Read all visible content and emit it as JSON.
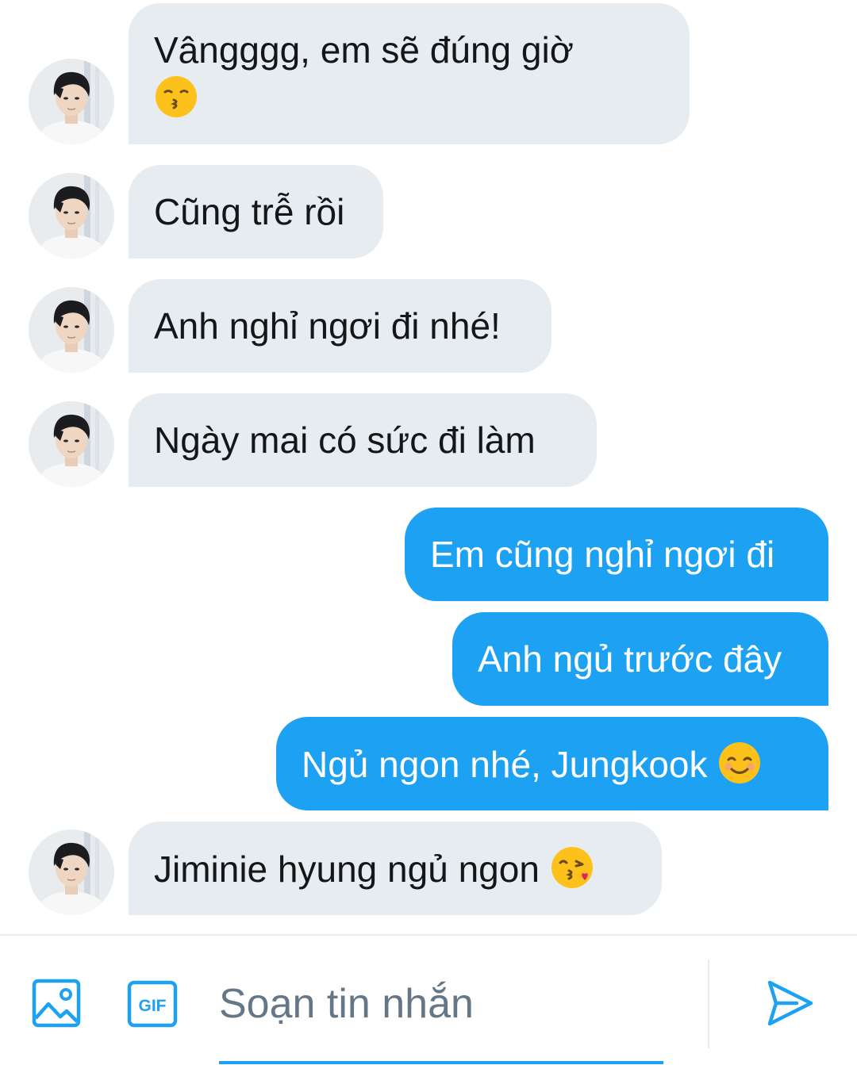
{
  "messages": [
    {
      "side": "in",
      "text_line1": "Vângggg, em sẽ đúng giờ",
      "emoji": "kissing-face"
    },
    {
      "side": "in",
      "text": "Cũng trễ rồi"
    },
    {
      "side": "in",
      "text": "Anh nghỉ ngơi đi nhé!"
    },
    {
      "side": "in",
      "text": "Ngày mai có sức đi làm"
    },
    {
      "side": "out",
      "text": "Em cũng nghỉ ngơi đi"
    },
    {
      "side": "out",
      "text": "Anh ngủ trước đây"
    },
    {
      "side": "out",
      "text": "Ngủ ngon nhé, Jungkook",
      "emoji": "smiling-face"
    },
    {
      "side": "in",
      "text": "Jiminie hyung ngủ ngon",
      "emoji": "face-blowing-kiss"
    }
  ],
  "composer": {
    "placeholder": "Soạn tin nhắn",
    "gif_label": "GIF",
    "media_icon": "image-icon",
    "send_icon": "send-icon"
  },
  "colors": {
    "incoming_bubble": "#e6ecf0",
    "outgoing_bubble": "#1da1f2",
    "accent": "#1da1f2",
    "placeholder_text": "#657786"
  }
}
